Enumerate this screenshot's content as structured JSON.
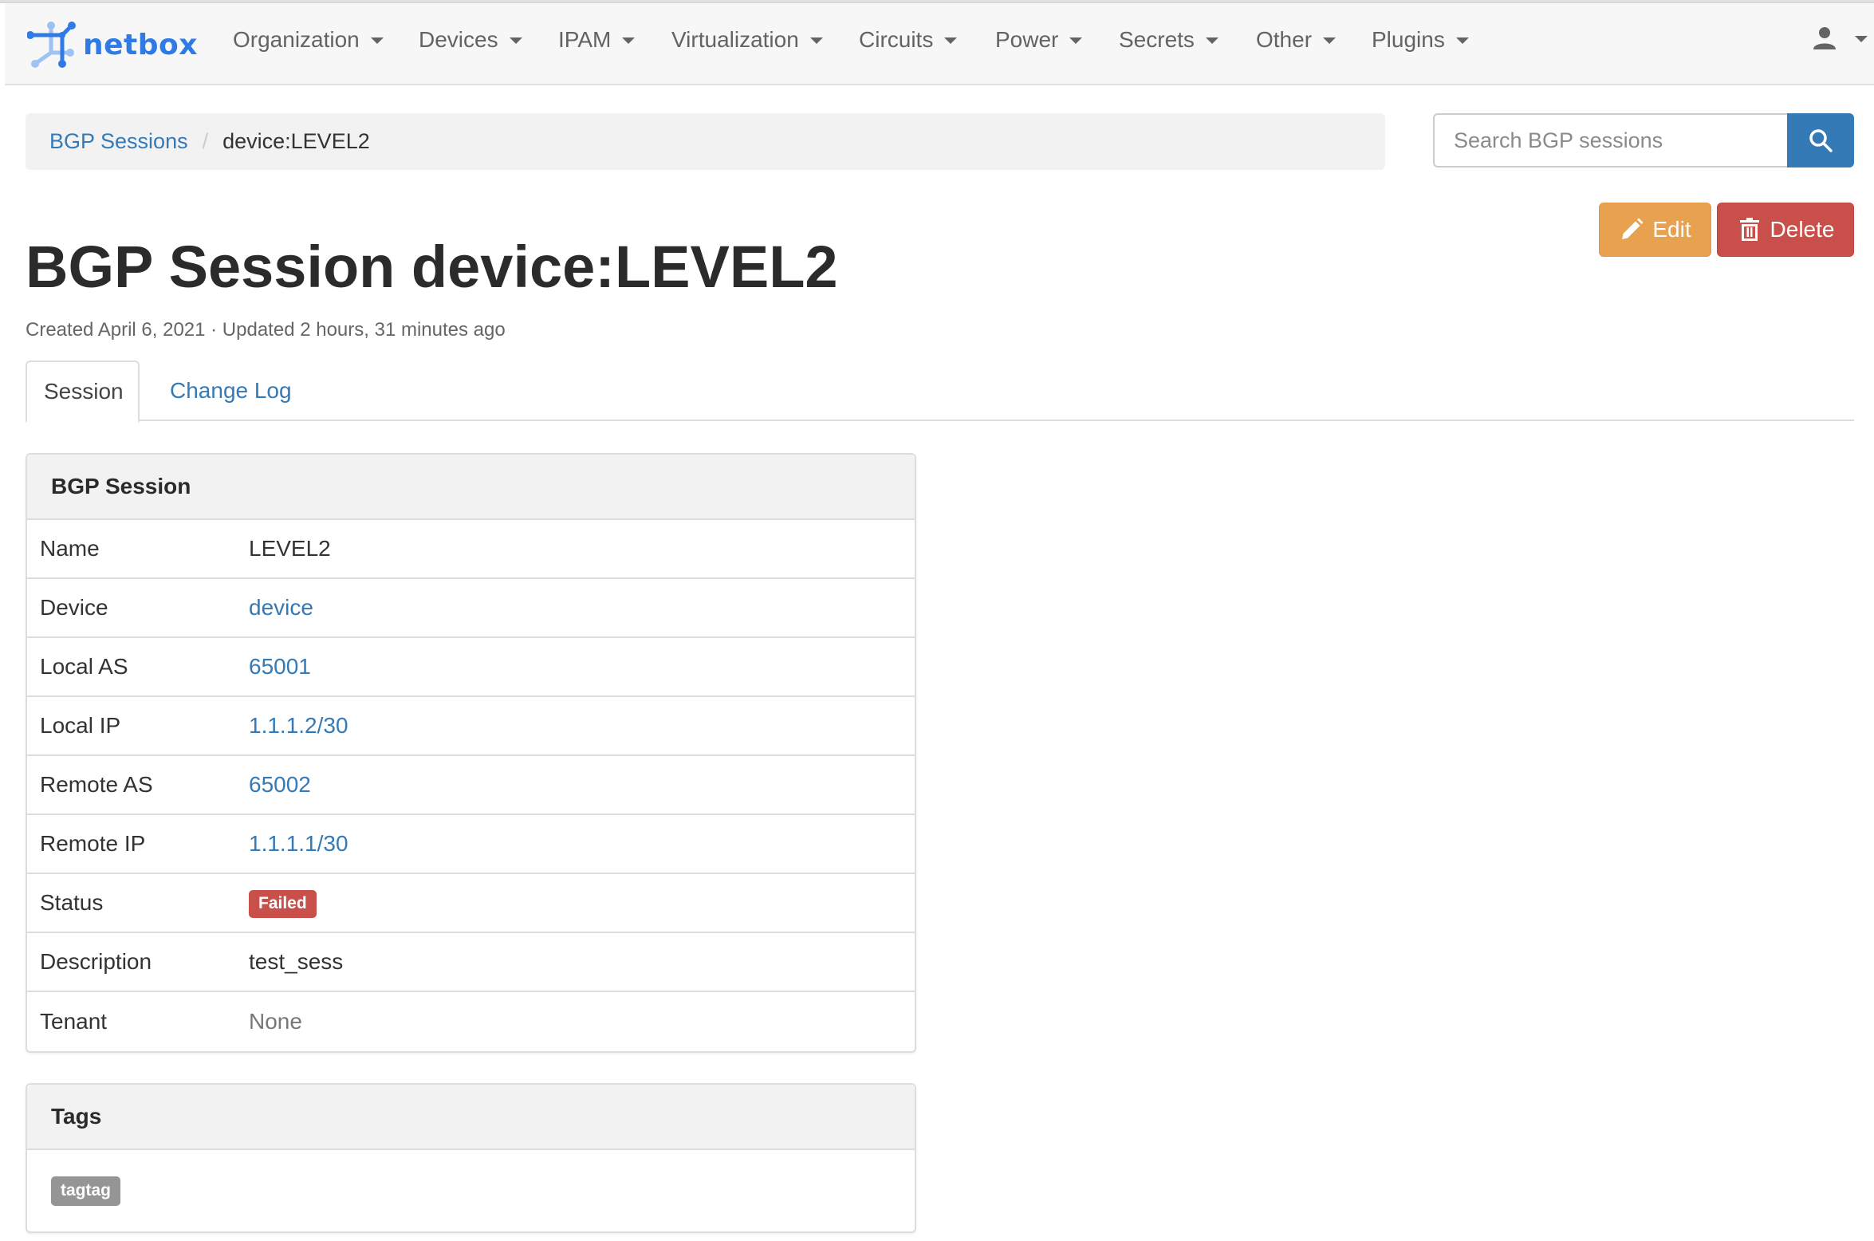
{
  "navbar": {
    "brand": "netbox",
    "items": [
      {
        "label": "Organization"
      },
      {
        "label": "Devices"
      },
      {
        "label": "IPAM"
      },
      {
        "label": "Virtualization"
      },
      {
        "label": "Circuits"
      },
      {
        "label": "Power"
      },
      {
        "label": "Secrets"
      },
      {
        "label": "Other"
      },
      {
        "label": "Plugins"
      }
    ],
    "user_icon": "user-icon"
  },
  "breadcrumb": {
    "parent": "BGP Sessions",
    "separator": "/",
    "current": "device:LEVEL2"
  },
  "search": {
    "placeholder": "Search BGP sessions",
    "value": "",
    "button_icon": "search-icon"
  },
  "actions": {
    "edit_label": "Edit",
    "delete_label": "Delete"
  },
  "page": {
    "title": "BGP Session device:LEVEL2",
    "meta": "Created April 6, 2021 · Updated 2 hours, 31 minutes ago"
  },
  "tabs": [
    {
      "label": "Session",
      "active": true
    },
    {
      "label": "Change Log",
      "active": false
    }
  ],
  "session_panel": {
    "title": "BGP Session",
    "rows": [
      {
        "label": "Name",
        "value": "LEVEL2",
        "type": "text"
      },
      {
        "label": "Device",
        "value": "device",
        "type": "link"
      },
      {
        "label": "Local AS",
        "value": "65001",
        "type": "link"
      },
      {
        "label": "Local IP",
        "value": "1.1.1.2/30",
        "type": "link"
      },
      {
        "label": "Remote AS",
        "value": "65002",
        "type": "link"
      },
      {
        "label": "Remote IP",
        "value": "1.1.1.1/30",
        "type": "link"
      },
      {
        "label": "Status",
        "value": "Failed",
        "type": "badge"
      },
      {
        "label": "Description",
        "value": "test_sess",
        "type": "text"
      },
      {
        "label": "Tenant",
        "value": "None",
        "type": "muted"
      }
    ]
  },
  "tags_panel": {
    "title": "Tags",
    "tags": [
      "tagtag"
    ]
  },
  "colors": {
    "brand": "#2f7ae5",
    "link": "#337ab7",
    "edit": "#e8a14e",
    "danger": "#c9504a",
    "tag": "#959595"
  }
}
